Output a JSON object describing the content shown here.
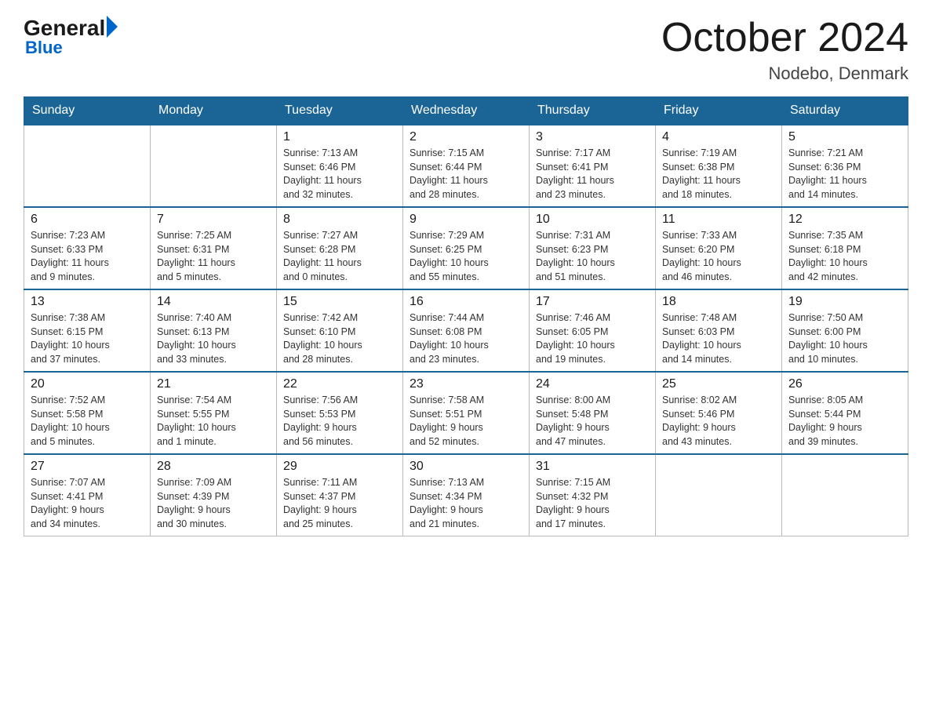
{
  "logo": {
    "general": "General",
    "blue": "Blue"
  },
  "title": "October 2024",
  "location": "Nodebo, Denmark",
  "days_header": [
    "Sunday",
    "Monday",
    "Tuesday",
    "Wednesday",
    "Thursday",
    "Friday",
    "Saturday"
  ],
  "weeks": [
    [
      {
        "num": "",
        "info": ""
      },
      {
        "num": "",
        "info": ""
      },
      {
        "num": "1",
        "info": "Sunrise: 7:13 AM\nSunset: 6:46 PM\nDaylight: 11 hours\nand 32 minutes."
      },
      {
        "num": "2",
        "info": "Sunrise: 7:15 AM\nSunset: 6:44 PM\nDaylight: 11 hours\nand 28 minutes."
      },
      {
        "num": "3",
        "info": "Sunrise: 7:17 AM\nSunset: 6:41 PM\nDaylight: 11 hours\nand 23 minutes."
      },
      {
        "num": "4",
        "info": "Sunrise: 7:19 AM\nSunset: 6:38 PM\nDaylight: 11 hours\nand 18 minutes."
      },
      {
        "num": "5",
        "info": "Sunrise: 7:21 AM\nSunset: 6:36 PM\nDaylight: 11 hours\nand 14 minutes."
      }
    ],
    [
      {
        "num": "6",
        "info": "Sunrise: 7:23 AM\nSunset: 6:33 PM\nDaylight: 11 hours\nand 9 minutes."
      },
      {
        "num": "7",
        "info": "Sunrise: 7:25 AM\nSunset: 6:31 PM\nDaylight: 11 hours\nand 5 minutes."
      },
      {
        "num": "8",
        "info": "Sunrise: 7:27 AM\nSunset: 6:28 PM\nDaylight: 11 hours\nand 0 minutes."
      },
      {
        "num": "9",
        "info": "Sunrise: 7:29 AM\nSunset: 6:25 PM\nDaylight: 10 hours\nand 55 minutes."
      },
      {
        "num": "10",
        "info": "Sunrise: 7:31 AM\nSunset: 6:23 PM\nDaylight: 10 hours\nand 51 minutes."
      },
      {
        "num": "11",
        "info": "Sunrise: 7:33 AM\nSunset: 6:20 PM\nDaylight: 10 hours\nand 46 minutes."
      },
      {
        "num": "12",
        "info": "Sunrise: 7:35 AM\nSunset: 6:18 PM\nDaylight: 10 hours\nand 42 minutes."
      }
    ],
    [
      {
        "num": "13",
        "info": "Sunrise: 7:38 AM\nSunset: 6:15 PM\nDaylight: 10 hours\nand 37 minutes."
      },
      {
        "num": "14",
        "info": "Sunrise: 7:40 AM\nSunset: 6:13 PM\nDaylight: 10 hours\nand 33 minutes."
      },
      {
        "num": "15",
        "info": "Sunrise: 7:42 AM\nSunset: 6:10 PM\nDaylight: 10 hours\nand 28 minutes."
      },
      {
        "num": "16",
        "info": "Sunrise: 7:44 AM\nSunset: 6:08 PM\nDaylight: 10 hours\nand 23 minutes."
      },
      {
        "num": "17",
        "info": "Sunrise: 7:46 AM\nSunset: 6:05 PM\nDaylight: 10 hours\nand 19 minutes."
      },
      {
        "num": "18",
        "info": "Sunrise: 7:48 AM\nSunset: 6:03 PM\nDaylight: 10 hours\nand 14 minutes."
      },
      {
        "num": "19",
        "info": "Sunrise: 7:50 AM\nSunset: 6:00 PM\nDaylight: 10 hours\nand 10 minutes."
      }
    ],
    [
      {
        "num": "20",
        "info": "Sunrise: 7:52 AM\nSunset: 5:58 PM\nDaylight: 10 hours\nand 5 minutes."
      },
      {
        "num": "21",
        "info": "Sunrise: 7:54 AM\nSunset: 5:55 PM\nDaylight: 10 hours\nand 1 minute."
      },
      {
        "num": "22",
        "info": "Sunrise: 7:56 AM\nSunset: 5:53 PM\nDaylight: 9 hours\nand 56 minutes."
      },
      {
        "num": "23",
        "info": "Sunrise: 7:58 AM\nSunset: 5:51 PM\nDaylight: 9 hours\nand 52 minutes."
      },
      {
        "num": "24",
        "info": "Sunrise: 8:00 AM\nSunset: 5:48 PM\nDaylight: 9 hours\nand 47 minutes."
      },
      {
        "num": "25",
        "info": "Sunrise: 8:02 AM\nSunset: 5:46 PM\nDaylight: 9 hours\nand 43 minutes."
      },
      {
        "num": "26",
        "info": "Sunrise: 8:05 AM\nSunset: 5:44 PM\nDaylight: 9 hours\nand 39 minutes."
      }
    ],
    [
      {
        "num": "27",
        "info": "Sunrise: 7:07 AM\nSunset: 4:41 PM\nDaylight: 9 hours\nand 34 minutes."
      },
      {
        "num": "28",
        "info": "Sunrise: 7:09 AM\nSunset: 4:39 PM\nDaylight: 9 hours\nand 30 minutes."
      },
      {
        "num": "29",
        "info": "Sunrise: 7:11 AM\nSunset: 4:37 PM\nDaylight: 9 hours\nand 25 minutes."
      },
      {
        "num": "30",
        "info": "Sunrise: 7:13 AM\nSunset: 4:34 PM\nDaylight: 9 hours\nand 21 minutes."
      },
      {
        "num": "31",
        "info": "Sunrise: 7:15 AM\nSunset: 4:32 PM\nDaylight: 9 hours\nand 17 minutes."
      },
      {
        "num": "",
        "info": ""
      },
      {
        "num": "",
        "info": ""
      }
    ]
  ]
}
